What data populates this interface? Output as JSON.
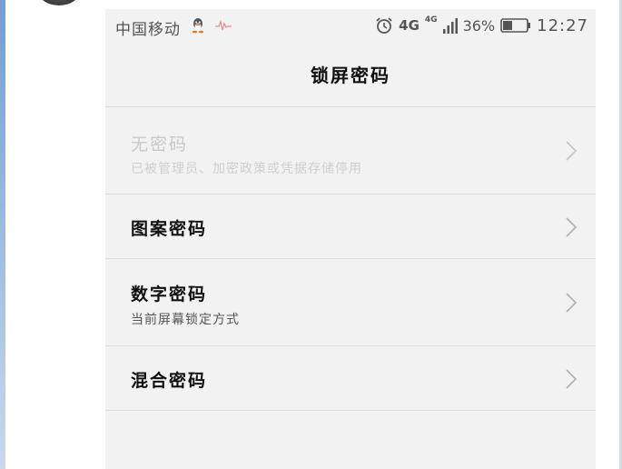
{
  "status_bar": {
    "carrier": "中国移动",
    "network": "4G",
    "network_small": "4G",
    "battery": "36%",
    "time": "12:27",
    "icons": [
      "qq-icon",
      "pulse-icon",
      "alarm-icon",
      "signal-icon",
      "battery-icon"
    ]
  },
  "header": {
    "title": "锁屏密码"
  },
  "options": [
    {
      "label": "无密码",
      "sublabel": "已被管理员、加密政策或凭据存储停用",
      "enabled": false
    },
    {
      "label": "图案密码",
      "sublabel": "",
      "enabled": true
    },
    {
      "label": "数字密码",
      "sublabel": "当前屏幕锁定方式",
      "enabled": true
    },
    {
      "label": "混合密码",
      "sublabel": "",
      "enabled": true
    }
  ],
  "colors": {
    "background": "#f2f2f2",
    "divider": "#dcdcdc",
    "text": "#111111",
    "disabled_text": "#c9c9c9"
  }
}
